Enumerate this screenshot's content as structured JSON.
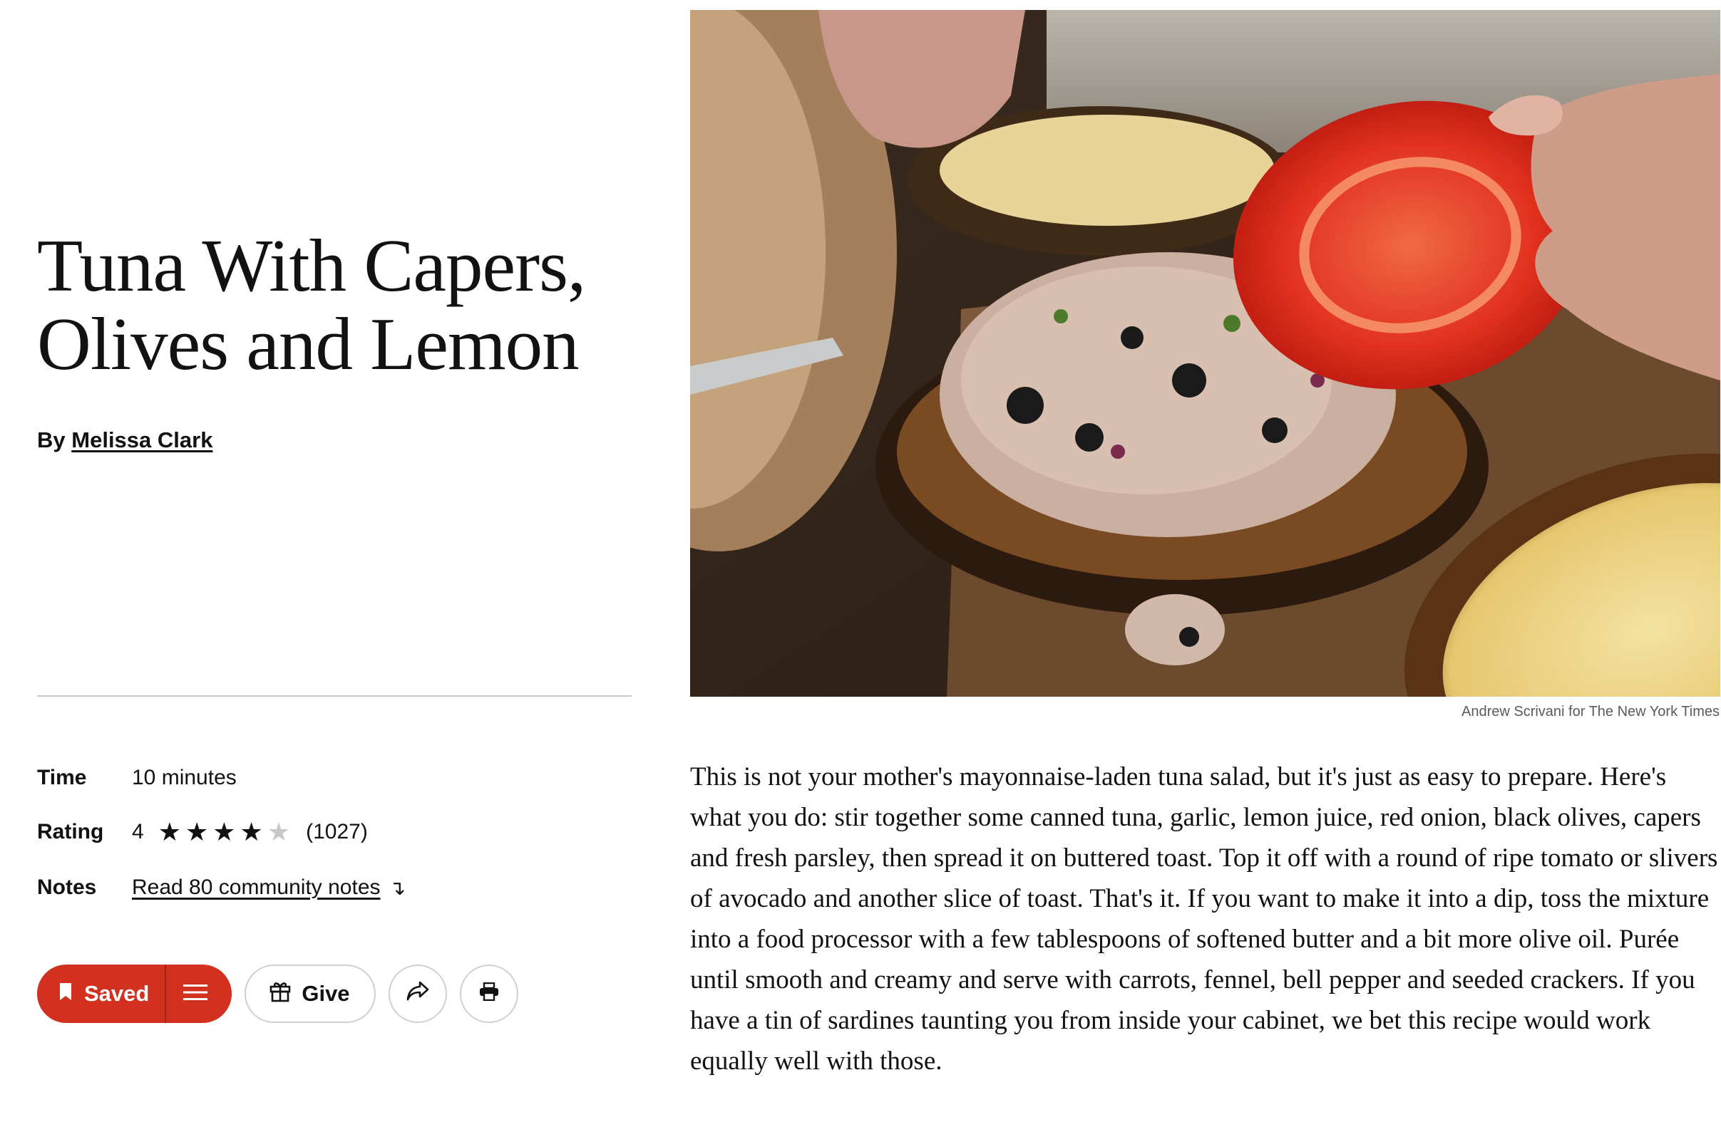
{
  "recipe": {
    "title": "Tuna With Capers, Olives and Lemon",
    "byline_prefix": "By",
    "author": "Melissa Clark"
  },
  "meta": {
    "time_label": "Time",
    "time_value": "10 minutes",
    "rating_label": "Rating",
    "rating_value": "4",
    "rating_stars_filled": 4,
    "rating_stars_total": 5,
    "rating_count": "(1027)",
    "notes_label": "Notes",
    "notes_link": "Read 80 community notes"
  },
  "actions": {
    "saved_label": "Saved",
    "give_label": "Give",
    "accent_color": "#d3311f"
  },
  "image": {
    "credit": "Andrew Scrivani for The New York Times"
  },
  "description": "This is not your mother's mayonnaise-laden tuna salad, but it's just as easy to prepare. Here's what you do: stir together some canned tuna, garlic, lemon juice, red onion, black olives, capers and fresh parsley, then spread it on buttered toast. Top it off with a round of ripe tomato or slivers of avocado and another slice of toast. That's it. If you want to make it into a dip, toss the mixture into a food processor with a few tablespoons of softened butter and a bit more olive oil. Purée until smooth and creamy and serve with carrots, fennel, bell pepper and seeded crackers. If you have a tin of sardines taunting you from inside your cabinet, we bet this recipe would work equally well with those."
}
